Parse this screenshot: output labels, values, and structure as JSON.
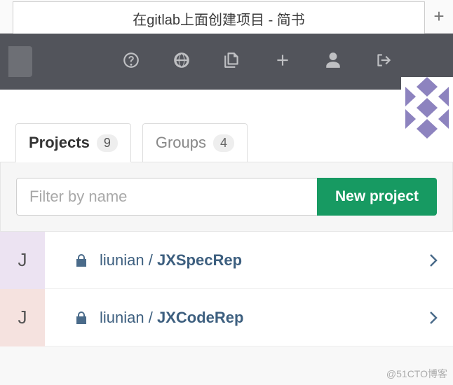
{
  "browser": {
    "tab_title": "在gitlab上面创建项目 - 简书",
    "new_tab_glyph": "+"
  },
  "navbar": {
    "icons": [
      "help-icon",
      "globe-icon",
      "files-icon",
      "plus-icon",
      "user-icon",
      "logout-icon"
    ]
  },
  "tabs": [
    {
      "label": "Projects",
      "count": "9",
      "active": true
    },
    {
      "label": "Groups",
      "count": "4",
      "active": false
    }
  ],
  "filter": {
    "placeholder": "Filter by name",
    "value": ""
  },
  "new_project_label": "New project",
  "projects": [
    {
      "initial": "J",
      "avatar_color": "purple",
      "owner": "liunian",
      "name": "JXSpecRep",
      "private": true
    },
    {
      "initial": "J",
      "avatar_color": "red",
      "owner": "liunian",
      "name": "JXCodeRep",
      "private": true
    }
  ],
  "watermark": "@51CTO博客"
}
